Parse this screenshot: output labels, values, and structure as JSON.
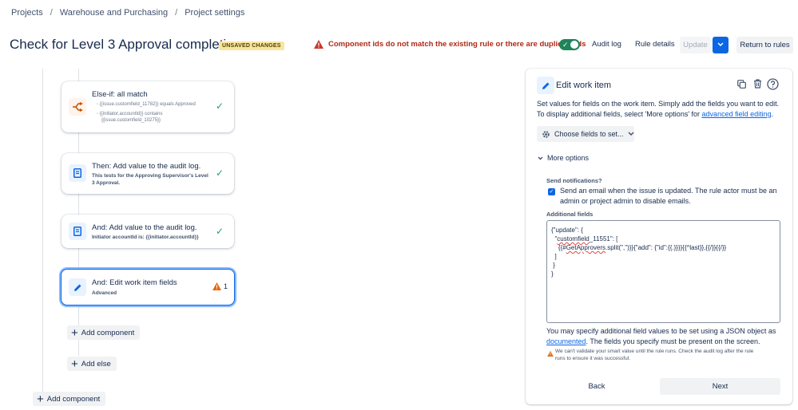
{
  "breadcrumb": [
    "Projects",
    "Warehouse and Purchasing",
    "Project settings"
  ],
  "header": {
    "title": "Check for Level 3 Approval completion.",
    "unsaved_badge": "UNSAVED CHANGES",
    "error": "Component ids do not match the existing rule or there are duplicate ids",
    "audit_log": "Audit log",
    "rule_details": "Rule details",
    "update": "Update",
    "return_to_rules": "Return to rules"
  },
  "flow": {
    "else_if": {
      "title": "Else-if: all match",
      "conditions": [
        "{{issue.customfield_11782}} equals Approved",
        "{{initiator.accountId}} contains",
        "{{issue.customfield_10275}}"
      ]
    },
    "then_audit": {
      "title": "Then: Add value to the audit log.",
      "sub": "This tests for the Approving Supervisor's Level 3 Approval."
    },
    "and_audit": {
      "title": "And: Add value to the audit log.",
      "sub": "Initiator accountId is: {{initiator.accountId}}"
    },
    "and_edit": {
      "title": "And: Edit work item fields",
      "sub": "Advanced",
      "warning_count": "1"
    },
    "add_component_inner": "Add component",
    "add_else": "Add else",
    "add_component_outer": "Add component"
  },
  "panel": {
    "title": "Edit work item",
    "desc_line1": "Set values for fields on the work item. Simply add the fields you want to edit.",
    "desc_line2": "To display additional fields, select 'More options' for ",
    "desc_link": "advanced field editing",
    "desc_end": ".",
    "choose_fields": "Choose fields to set...",
    "more_options": "More options",
    "send_notifications_label": "Send notifications?",
    "send_email_line1": "Send an email when the issue is updated. The rule actor must be an",
    "send_email_line2": "admin or project admin to disable emails.",
    "additional_fields_label": "Additional fields",
    "json_lines": [
      "{\"update\": {",
      "  \"customfield_11551\": [",
      "    {{#GetApprovers.split(\",\")}}{\"add\": {\"id\":{{.}}}}{{^last}},{{/}}{{/}}",
      "  ]",
      " }",
      "}"
    ],
    "json_wavy_word_1": "customfield",
    "json_wavy_word_2": "GetApprovers",
    "help_line1": "You may specify additional field values to be set using a JSON object as",
    "help_link": "documented",
    "help_line2": ". The fields you specify must be present on the screen.",
    "warning_line1": "We can't validate your smart value until the rule runs. Check the audit log after the rule",
    "warning_line2": "runs to ensure it was successful.",
    "back": "Back",
    "next": "Next"
  },
  "colors": {
    "accent": "#0c66e4",
    "error": "#ae2a19",
    "success": "#22a06b",
    "warning": "#e56910",
    "badge": "#f8e6a0"
  }
}
